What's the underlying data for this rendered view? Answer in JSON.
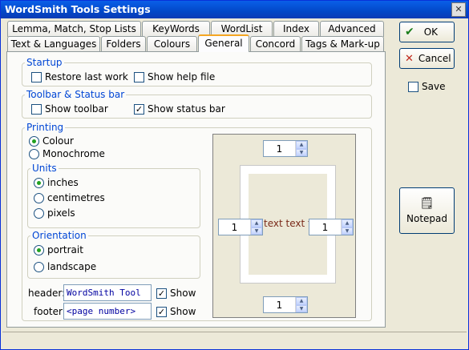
{
  "window": {
    "title": "WordSmith Tools Settings",
    "close_icon": "close-icon"
  },
  "tabs_row1": [
    "Lemma, Match, Stop Lists",
    "KeyWords",
    "WordList",
    "Index",
    "Advanced"
  ],
  "tabs_row2": [
    "Text & Languages",
    "Folders",
    "Colours",
    "General",
    "Concord",
    "Tags & Mark-up"
  ],
  "active_tab": "General",
  "startup": {
    "label": "Startup",
    "restore": "Restore last work",
    "help": "Show help file",
    "restore_checked": false,
    "help_checked": false
  },
  "toolbar": {
    "label": "Toolbar & Status bar",
    "show_toolbar": "Show toolbar",
    "show_status": "Show status bar",
    "toolbar_checked": false,
    "status_checked": true
  },
  "printing": {
    "label": "Printing",
    "colour": "Colour",
    "mono": "Monochrome",
    "selected": "Colour"
  },
  "units": {
    "label": "Units",
    "options": [
      "inches",
      "centimetres",
      "pixels"
    ],
    "selected": "inches"
  },
  "orientation": {
    "label": "Orientation",
    "options": [
      "portrait",
      "landscape"
    ],
    "selected": "portrait"
  },
  "header": {
    "label": "header:",
    "value": "WordSmith Tool",
    "show": "Show",
    "checked": true
  },
  "footer": {
    "label": "footer:",
    "value": "<page number>",
    "show": "Show",
    "checked": true
  },
  "margins": {
    "top": "1",
    "left": "1",
    "right": "1",
    "bottom": "1",
    "sample_text": "text text tex"
  },
  "buttons": {
    "ok": "OK",
    "cancel": "Cancel",
    "save": "Save",
    "notepad": "Notepad"
  },
  "colors": {
    "ok_icon": "#1a7d1a",
    "cancel_icon": "#c0281c",
    "group_label": "#0046d5",
    "sample_text": "#7a2a1a"
  }
}
